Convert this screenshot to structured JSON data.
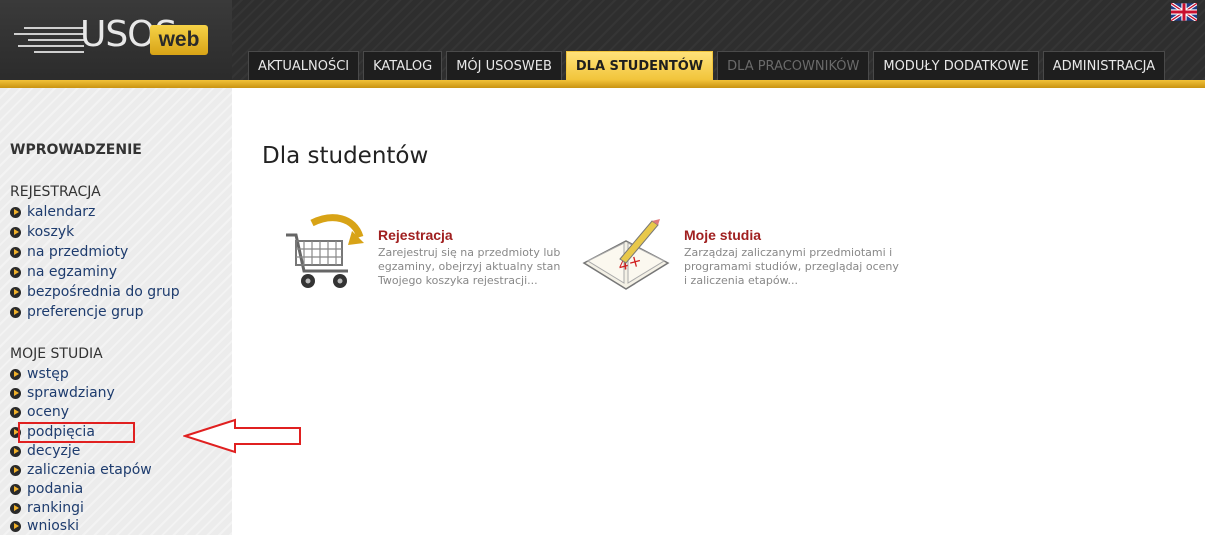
{
  "logo": {
    "brand": "USOS",
    "badge": "web"
  },
  "nav": {
    "tabs": [
      {
        "label": "AKTUALNOŚCI",
        "state": "normal"
      },
      {
        "label": "KATALOG",
        "state": "normal"
      },
      {
        "label": "MÓJ USOSWEB",
        "state": "normal"
      },
      {
        "label": "DLA STUDENTÓW",
        "state": "active"
      },
      {
        "label": "DLA PRACOWNIKÓW",
        "state": "disabled"
      },
      {
        "label": "MODUŁY DODATKOWE",
        "state": "normal"
      },
      {
        "label": "ADMINISTRACJA",
        "state": "normal"
      }
    ],
    "language_icon": "uk-flag-icon"
  },
  "sidebar": {
    "intro": "WPROWADZENIE",
    "sections": [
      {
        "title": "REJESTRACJA",
        "items": [
          "kalendarz",
          "koszyk",
          "na przedmioty",
          "na egzaminy",
          "bezpośrednia do grup",
          "preferencje grup"
        ]
      },
      {
        "title": "MOJE STUDIA",
        "items": [
          "wstęp",
          "sprawdziany",
          "oceny",
          "podpięcia",
          "decyzje",
          "zaliczenia etapów",
          "podania",
          "rankingi",
          "wnioski"
        ]
      }
    ],
    "highlighted_item": "podpięcia"
  },
  "main": {
    "title": "Dla studentów",
    "cards": [
      {
        "title": "Rejestracja",
        "icon": "shopping-cart-icon",
        "desc": "Zarejestruj się na przedmioty lub egzaminy, obejrzyj aktualny stan Twojego koszyka rejestracji..."
      },
      {
        "title": "Moje studia",
        "icon": "gradebook-icon",
        "desc": "Zarządzaj zaliczanymi przedmiotami i programami studiów, przeglądaj oceny i zaliczenia etapów..."
      }
    ]
  },
  "colors": {
    "accent": "#f1c43a",
    "annotation": "#e02020",
    "card_title": "#a02020"
  }
}
